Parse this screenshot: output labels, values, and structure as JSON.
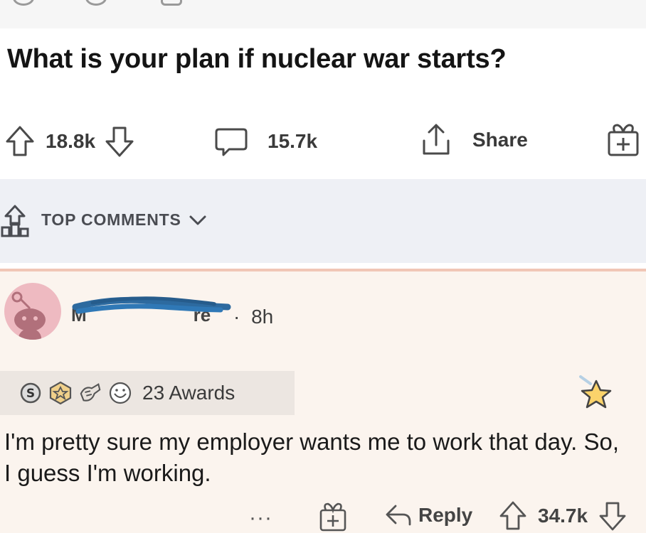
{
  "post": {
    "title": "What is your plan if nuclear war starts?",
    "upvotes": "18.8k",
    "comments": "15.7k",
    "share_label": "Share"
  },
  "comments_section": {
    "sort_label": "TOP COMMENTS"
  },
  "comment": {
    "username": "M",
    "username_suffix": "re",
    "time_separator": "·",
    "time": "8h",
    "awards_label": "23 Awards",
    "body": "I'm pretty sure my employer wants me to work that day. So, I guess I'm working.",
    "more_label": "···",
    "reply_label": "Reply",
    "votes": "34.7k"
  },
  "colors": {
    "comment_bg": "#fbf4ee",
    "comments_bar_bg": "#eef0f5",
    "avatar_bg": "#eebac1",
    "award_star": "#f3b23a"
  },
  "icons": {
    "upvote": "up-arrow-icon",
    "downvote": "down-arrow-icon",
    "comment": "comment-bubble-icon",
    "share": "share-icon",
    "gift": "gift-icon",
    "sort": "sort-bars-icon",
    "chevron": "chevron-down-icon",
    "reply": "reply-arrow-icon",
    "star": "star-award-icon"
  }
}
